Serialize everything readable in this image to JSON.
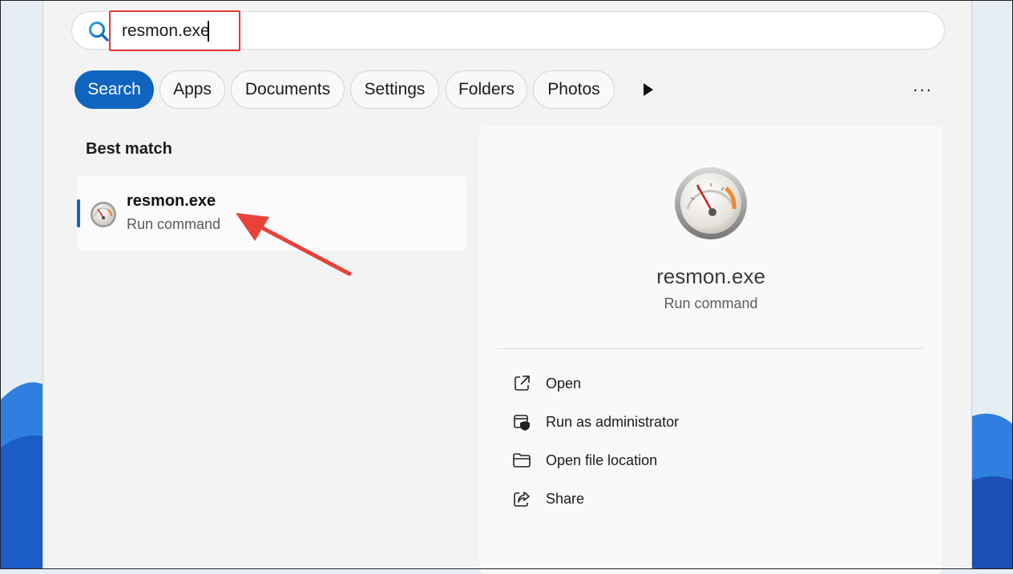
{
  "search": {
    "value": "resmon.exe"
  },
  "filters": [
    {
      "label": "Search",
      "active": true
    },
    {
      "label": "Apps",
      "active": false
    },
    {
      "label": "Documents",
      "active": false
    },
    {
      "label": "Settings",
      "active": false
    },
    {
      "label": "Folders",
      "active": false
    },
    {
      "label": "Photos",
      "active": false
    }
  ],
  "more_label": "···",
  "best_match": {
    "heading": "Best match",
    "item": {
      "title": "resmon.exe",
      "subtitle": "Run command"
    }
  },
  "details": {
    "title": "resmon.exe",
    "subtitle": "Run command",
    "actions": [
      {
        "label": "Open",
        "icon": "open-external-icon"
      },
      {
        "label": "Run as administrator",
        "icon": "shield-admin-icon"
      },
      {
        "label": "Open file location",
        "icon": "folder-icon"
      },
      {
        "label": "Share",
        "icon": "share-icon"
      }
    ]
  },
  "colors": {
    "accent": "#0f64c0",
    "highlight_box": "#e53935",
    "annotation_arrow": "#e8423a"
  }
}
